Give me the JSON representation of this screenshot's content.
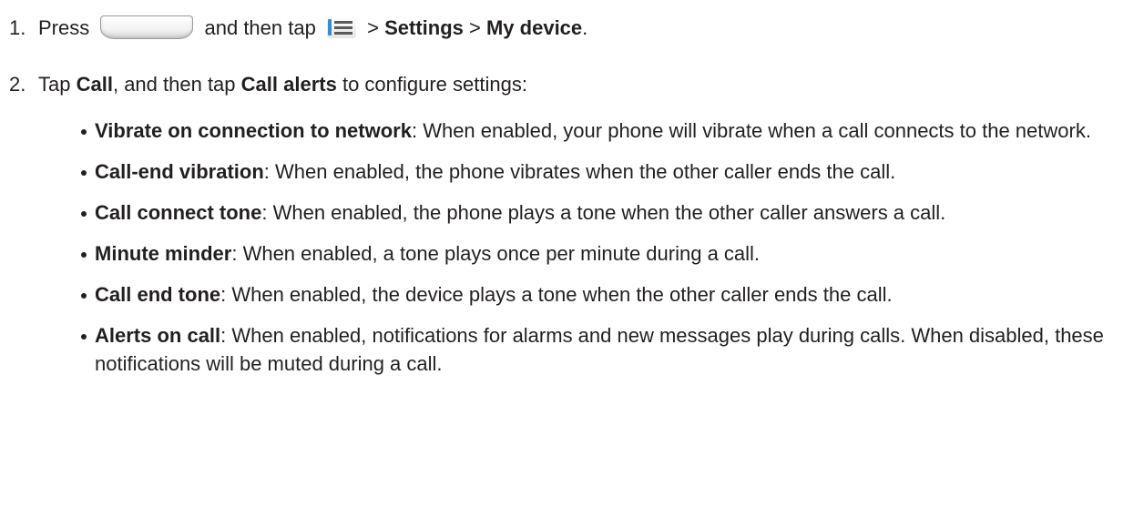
{
  "steps": [
    {
      "number": "1.",
      "press": "Press",
      "then_tap": "and then tap",
      "sep1": ">",
      "path1": "Settings",
      "sep2": ">",
      "path2": "My device",
      "end": "."
    },
    {
      "number": "2.",
      "tap": "Tap",
      "item1": "Call",
      "mid": ", and then tap",
      "item2": "Call alerts",
      "end": "to configure settings:"
    }
  ],
  "icons": {
    "home_key": "home-key-icon",
    "menu_key": "menu-key-icon"
  },
  "options": [
    {
      "term": "Vibrate on connection to network",
      "desc": ": When enabled, your phone will vibrate when a call connects to the network."
    },
    {
      "term": "Call-end vibration",
      "desc": ": When enabled, the phone vibrates when the other caller ends the call."
    },
    {
      "term": "Call connect tone",
      "desc": ": When enabled, the phone plays a tone when the other caller answers a call."
    },
    {
      "term": "Minute minder",
      "desc": ": When enabled, a tone plays once per minute during a call."
    },
    {
      "term": "Call end tone",
      "desc": ": When enabled, the device plays a tone when the other caller ends the call."
    },
    {
      "term": "Alerts on call",
      "desc": ": When enabled, notifications for alarms and new messages play during calls. When disabled, these notifications will be muted during a call."
    }
  ]
}
